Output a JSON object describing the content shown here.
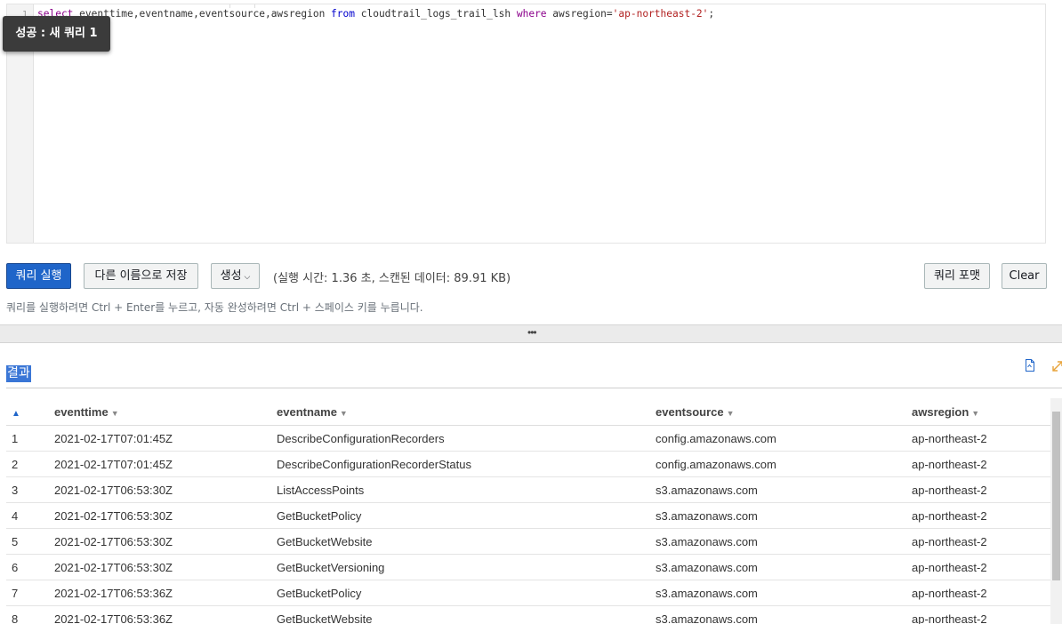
{
  "editor": {
    "line_number": "1",
    "query": {
      "kw_select": "select",
      "columns": " eventtime,eventname,eventsource,awsregion ",
      "kw_from": "from",
      "table": " cloudtrail_logs_trail_lsh ",
      "kw_where": "where",
      "cond": " awsregion=",
      "value": "'ap-northeast-2'",
      "end": ";"
    }
  },
  "toast": {
    "text": "성공 : 새 쿼리 1"
  },
  "actions": {
    "run": "쿼리 실행",
    "save_as": "다른 이름으로 저장",
    "create": "생성",
    "create_chevron": "⌵",
    "exec_info": "(실행 시간: 1.36 초, 스캔된 데이터: 89.91 KB)",
    "format": "쿼리 포맷",
    "clear": "Clear"
  },
  "hint": "쿼리를 실행하려면 Ctrl + Enter를 누르고, 자동 완성하려면 Ctrl + 스페이스 키를 누릅니다.",
  "splitter": {
    "handle": "•••"
  },
  "results": {
    "title": "결과",
    "columns": [
      "eventtime",
      "eventname",
      "eventsource",
      "awsregion"
    ],
    "rows": [
      {
        "n": "1",
        "eventtime": "2021-02-17T07:01:45Z",
        "eventname": "DescribeConfigurationRecorders",
        "eventsource": "config.amazonaws.com",
        "awsregion": "ap-northeast-2"
      },
      {
        "n": "2",
        "eventtime": "2021-02-17T07:01:45Z",
        "eventname": "DescribeConfigurationRecorderStatus",
        "eventsource": "config.amazonaws.com",
        "awsregion": "ap-northeast-2"
      },
      {
        "n": "3",
        "eventtime": "2021-02-17T06:53:30Z",
        "eventname": "ListAccessPoints",
        "eventsource": "s3.amazonaws.com",
        "awsregion": "ap-northeast-2"
      },
      {
        "n": "4",
        "eventtime": "2021-02-17T06:53:30Z",
        "eventname": "GetBucketPolicy",
        "eventsource": "s3.amazonaws.com",
        "awsregion": "ap-northeast-2"
      },
      {
        "n": "5",
        "eventtime": "2021-02-17T06:53:30Z",
        "eventname": "GetBucketWebsite",
        "eventsource": "s3.amazonaws.com",
        "awsregion": "ap-northeast-2"
      },
      {
        "n": "6",
        "eventtime": "2021-02-17T06:53:30Z",
        "eventname": "GetBucketVersioning",
        "eventsource": "s3.amazonaws.com",
        "awsregion": "ap-northeast-2"
      },
      {
        "n": "7",
        "eventtime": "2021-02-17T06:53:36Z",
        "eventname": "GetBucketPolicy",
        "eventsource": "s3.amazonaws.com",
        "awsregion": "ap-northeast-2"
      },
      {
        "n": "8",
        "eventtime": "2021-02-17T06:53:36Z",
        "eventname": "GetBucketWebsite",
        "eventsource": "s3.amazonaws.com",
        "awsregion": "ap-northeast-2"
      }
    ]
  },
  "colors": {
    "primary": "#1f65c9",
    "selection": "#3a76d6"
  },
  "icons": {
    "doc": "document-icon",
    "expand": "expand-icon",
    "sort_up": "sort-ascending-icon",
    "sort": "sort-caret-icon"
  }
}
